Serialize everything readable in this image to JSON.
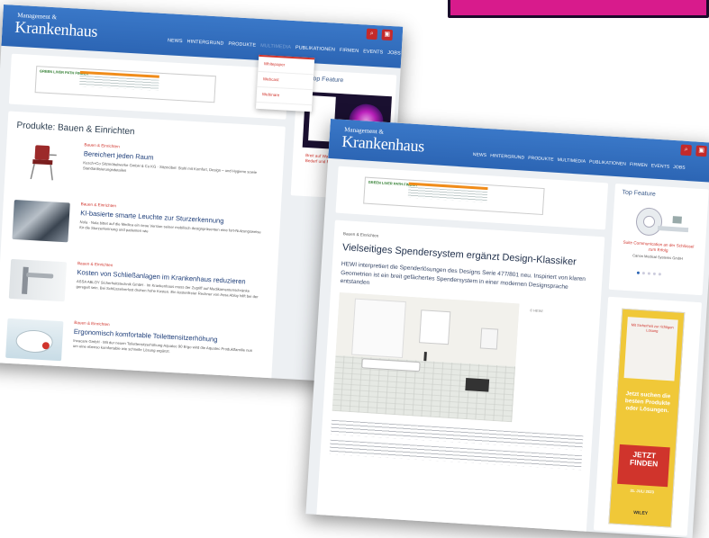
{
  "brand": {
    "line1": "Management &",
    "line2": "Krankenhaus"
  },
  "nav_back": [
    "NEWS",
    "HINTERGRUND",
    "PRODUKTE",
    "MULTIMEDIA",
    "PUBLIKATIONEN",
    "FIRMEN",
    "EVENTS",
    "JOBS"
  ],
  "nav_front": [
    "NEWS",
    "HINTERGRUND",
    "PRODUKTE",
    "MULTIMEDIA",
    "PUBLIKATIONEN",
    "FIRMEN",
    "EVENTS",
    "JOBS"
  ],
  "dropdown": [
    "Whitepaper",
    "Webcast",
    "Webinare"
  ],
  "ad_brand": "GREEN LIVER\nPATH\nFINDER",
  "back": {
    "section_title": "Produkte: Bauen & Einrichten",
    "top_feature": "Top Feature",
    "items": [
      {
        "category": "Bauen & Einrichten",
        "title": "Bereichert jeden Raum",
        "desc": "Kusch+Co Sitzmöbelwerke GmbH & Co KG · Sitzmöbel: Stuhl mit Komfort, Design – und Hygiene sowie Standardisierungsdetailen"
      },
      {
        "category": "Bauen & Einrichten",
        "title": "KI-basierte smarte Leuchte zur Sturzerkennung",
        "desc": "Nola · Nola bittet auf die Medica ein neue Version seiner mobilisch designpräsenten eine fort-Nutzungsweise für die Sturzerkennung und patienten wie"
      },
      {
        "category": "Bauen & Einrichten",
        "title": "Kosten von Schließanlagen im Krankenhaus reduzieren",
        "desc": "ASSA ABLOY Sicherheitstechnik GmbH · Im Krankenhaus muss der Zugriff auf Medikamentenschränke geregelt sein. Bei Schlüsselverlust drohen hohe Kosten. Ein kostenfreier Rechner von Assa Abloy hilft bei der"
      },
      {
        "category": "Bauen & Einrichten",
        "title": "Ergonomisch komfortable Toilettensitzerhöhung",
        "desc": "Invacare GmbH · Mit der neuen Toilettensitzerhöhung Aquatec 90 Ergo wird die Aquatec Produktfamilie nun um eine ebenso komfortable wie schnelle Lösung ergänzt."
      }
    ],
    "side_text": "Breit auf Wandelbarkeit Bedarf und Pla..."
  },
  "front": {
    "top_feature": "Top Feature",
    "feature_caption": "Suite Communication an der Schlüssel zum Erfolg",
    "feature_company": "Canon Medical Systems GmbH",
    "category": "Bauen & Einrichten",
    "title": "Vielseitiges Spendersystem ergänzt Design-Klassiker",
    "lead": "HEWI interpretiert die Spenderlösungen des Designs Serie 477/801 neu. Inspiriert von klaren Geometrien ist ein breit gefächertes Spendersystem in einer modernen Designsprache entstanden",
    "photo_credit": "© HEWI",
    "ad_sub": "Mit Sicherheit zur richtigen Lösung",
    "ad_text": "Jetzt suchen die besten Produkte oder Lösungen.",
    "ad_cta": "JETZT FINDEN",
    "ad_date": "31. JULI 2023",
    "ad_brand": "WILEY"
  }
}
